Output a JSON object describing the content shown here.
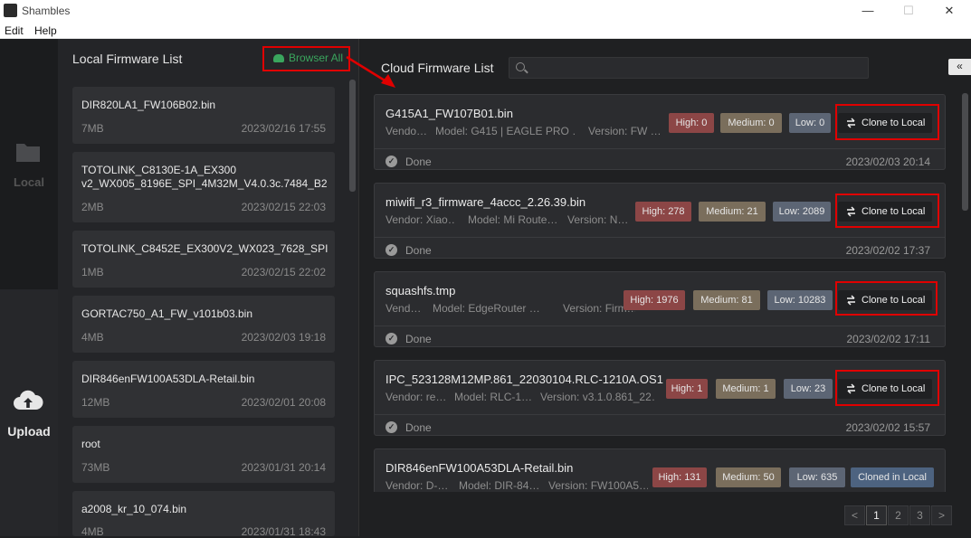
{
  "window": {
    "title": "Shambles",
    "minimize": "—",
    "maximize": "☐",
    "close": "✕"
  },
  "menu": {
    "items": [
      "Edit",
      "Help"
    ]
  },
  "nav": {
    "local_label": "Local",
    "upload_label": "Upload"
  },
  "local": {
    "heading": "Local Firmware List",
    "browse_label": "Browser All",
    "files": [
      {
        "name": "DIR820LA1_FW106B02.bin",
        "size": "7MB",
        "date": "2023/02/16 17:55"
      },
      {
        "name": "TOTOLINK_C8130E-1A_EX300 v2_WX005_8196E_SPI_4M32M_V4.0.3c.7484_B2…",
        "size": "2MB",
        "date": "2023/02/15 22:03"
      },
      {
        "name": "TOTOLINK_C8452E_EX300V2_WX023_7628_SPI…",
        "size": "1MB",
        "date": "2023/02/15 22:02"
      },
      {
        "name": "GORTAC750_A1_FW_v101b03.bin",
        "size": "4MB",
        "date": "2023/02/03 19:18"
      },
      {
        "name": "DIR846enFW100A53DLA-Retail.bin",
        "size": "12MB",
        "date": "2023/02/01 20:08"
      },
      {
        "name": "root",
        "size": "73MB",
        "date": "2023/01/31 20:14"
      },
      {
        "name": "a2008_kr_10_074.bin",
        "size": "4MB",
        "date": "2023/01/31 18:43"
      }
    ]
  },
  "cloud": {
    "heading": "Cloud Firmware List",
    "search_placeholder": "",
    "collapse_label": "«",
    "status_done": "Done",
    "clone_label": "Clone to Local",
    "cloned_label": "Cloned in Local",
    "items": [
      {
        "name": "G415A1_FW107B01.bin",
        "vendor": "Vendo…",
        "model": "Model: G415 | EAGLE PRO …",
        "version": "Version: FW …",
        "high": "High: 0",
        "medium": "Medium: 0",
        "low": "Low: 0",
        "date": "2023/02/03 20:14"
      },
      {
        "name": "miwifi_r3_firmware_4accc_2.26.39.bin",
        "vendor": "Vendor: Xiao…",
        "model": "Model: Mi Route…",
        "version": "Version: N…",
        "high": "High: 278",
        "medium": "Medium: 21",
        "low": "Low: 2089",
        "date": "2023/02/02 17:37"
      },
      {
        "name": "squashfs.tmp",
        "vendor": "Vend…",
        "model": "Model: EdgeRouter …",
        "version": "Version: Firm…",
        "high": "High: 1976",
        "medium": "Medium: 81",
        "low": "Low: 10283",
        "date": "2023/02/02 17:11"
      },
      {
        "name": "IPC_523128M12MP.861_22030104.RLC-1210A.OS1",
        "vendor": "Vendor: re…",
        "model": "Model: RLC-1…",
        "version": "Version: v3.1.0.861_22…",
        "high": "High: 1",
        "medium": "Medium: 1",
        "low": "Low: 23",
        "date": "2023/02/02 15:57"
      },
      {
        "name": "DIR846enFW100A53DLA-Retail.bin",
        "vendor": "Vendor: D-…",
        "model": "Model: DIR-84…",
        "version": "Version: FW100A5…",
        "high": "High: 131",
        "medium": "Medium: 50",
        "low": "Low: 635",
        "date": ""
      }
    ],
    "pagination": {
      "prev": "<",
      "pages": [
        "1",
        "2",
        "3"
      ],
      "next": ">",
      "current": "1"
    }
  },
  "colors": {
    "accent_green": "#3aa55d",
    "annotation_red": "#e00000",
    "high": "#8c4646",
    "medium": "#7a6e5c",
    "low": "#5c6574",
    "cloned": "#4d6380"
  },
  "icons": {
    "app": "app-logo-icon",
    "local": "folder-icon",
    "upload": "cloud-upload-icon",
    "browse": "cloud-icon",
    "search": "search-icon",
    "clone": "swap-arrows-icon",
    "done": "check-circle-icon"
  }
}
